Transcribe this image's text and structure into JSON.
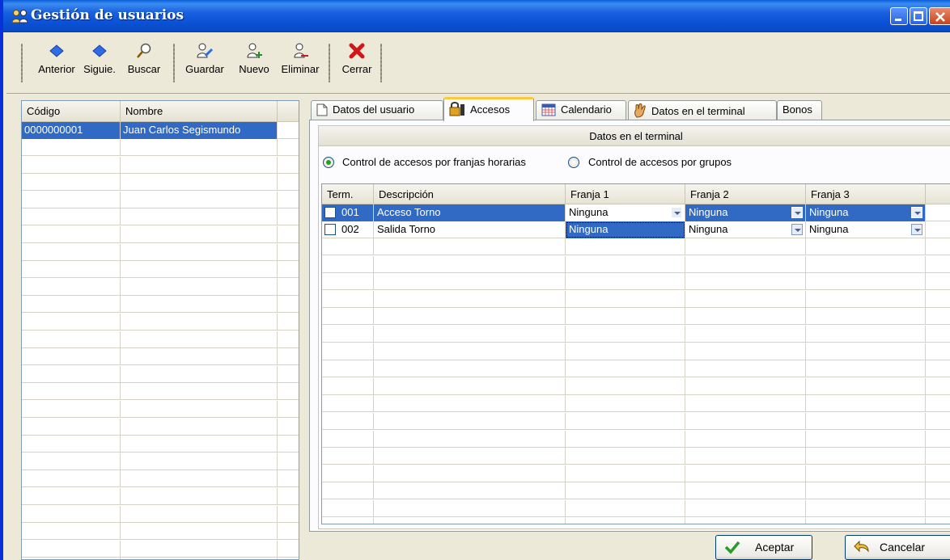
{
  "window": {
    "title": "Gestión de usuarios"
  },
  "toolbar": {
    "prev": "Anterior",
    "next": "Siguie.",
    "search": "Buscar",
    "save": "Guardar",
    "new": "Nuevo",
    "delete": "Eliminar",
    "close": "Cerrar"
  },
  "users_list": {
    "headers": {
      "code": "Código",
      "name": "Nombre"
    },
    "rows": [
      {
        "code": "0000000001",
        "name": "Juan Carlos Segismundo"
      }
    ]
  },
  "tabs": {
    "user_data": "Datos del usuario",
    "access": "Accesos",
    "calendar": "Calendario",
    "terminal_data": "Datos en el terminal",
    "bonuses": "Bonos"
  },
  "panel": {
    "group_title": "Datos en el terminal",
    "radio_timeslots": "Control de accesos por franjas horarias",
    "radio_groups": "Control de accesos por grupos",
    "selected_mode": "timeslots"
  },
  "access_grid": {
    "headers": {
      "term": "Term.",
      "desc": "Descripción",
      "slot1": "Franja 1",
      "slot2": "Franja 2",
      "slot3": "Franja 3"
    },
    "rows": [
      {
        "term": "001",
        "desc": "Acceso Torno",
        "slot1": "Ninguna",
        "slot2": "Ninguna",
        "slot3": "Ninguna"
      },
      {
        "term": "002",
        "desc": "Salida Torno",
        "slot1": "Ninguna",
        "slot2": "Ninguna",
        "slot3": "Ninguna"
      }
    ]
  },
  "buttons": {
    "accept": "Aceptar",
    "cancel": "Cancelar"
  },
  "colors": {
    "title_bar": "#0a5fd8",
    "selection": "#316ac5",
    "face": "#ece9d8"
  }
}
